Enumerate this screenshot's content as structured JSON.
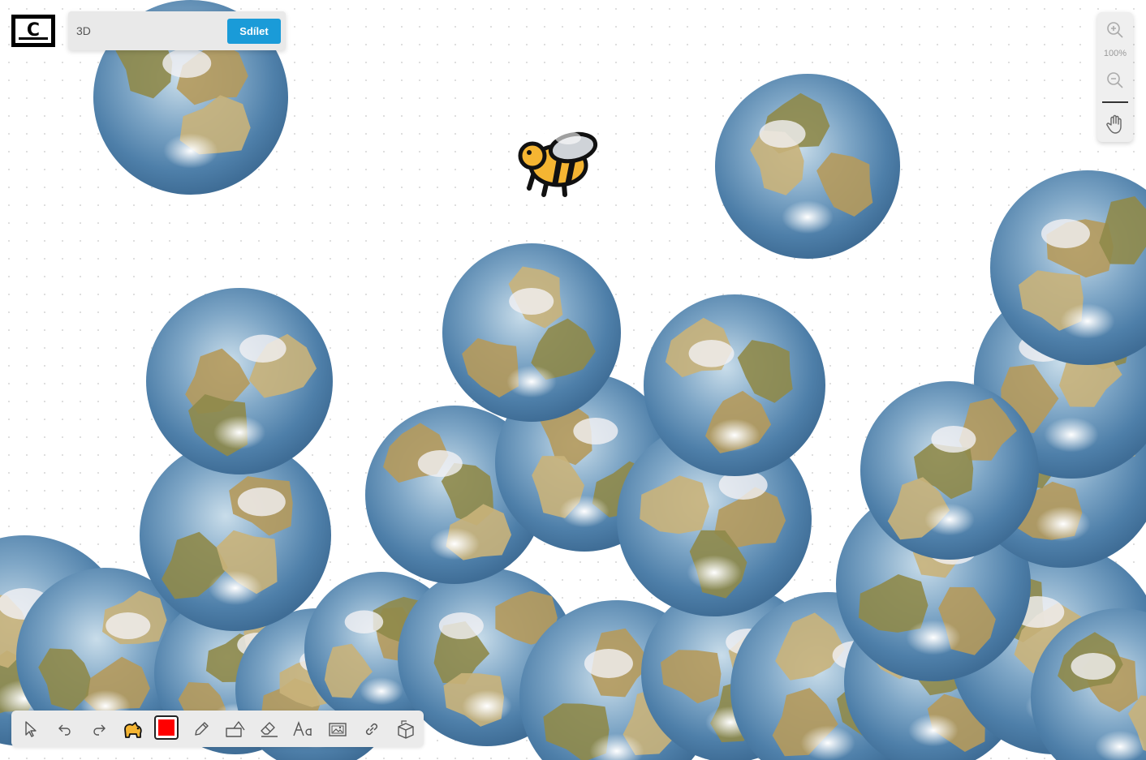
{
  "app": {
    "logo_letter": "C"
  },
  "share": {
    "input_value": "3D",
    "button_label": "Sdílet",
    "button_color": "#1a9bd8"
  },
  "zoom": {
    "level": "100%"
  },
  "toolbar": {
    "current_color": "#ff0000",
    "tools": [
      "select-arrow-icon",
      "undo-icon",
      "redo-icon",
      "sticker-icon",
      "color-picker",
      "pencil-icon",
      "shapes-icon",
      "eraser-icon",
      "text-icon",
      "image-icon",
      "link-icon",
      "3d-object-icon"
    ]
  },
  "canvas": {
    "sticker": "bee-icon",
    "globe_count": 26
  }
}
